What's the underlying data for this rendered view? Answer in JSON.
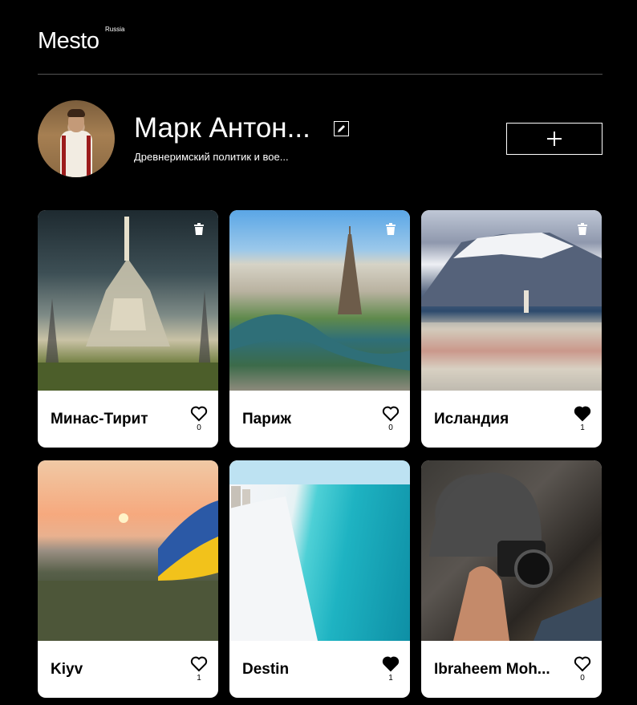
{
  "header": {
    "logo": "Mesto",
    "logo_sup": "Russia"
  },
  "profile": {
    "name": "Марк Антон...",
    "about": "Древнеримский политик и вое..."
  },
  "cards": [
    {
      "title": "Минас-Тирит",
      "likes": "0",
      "liked": false,
      "deletable": true,
      "image": "minas-tirith"
    },
    {
      "title": "Париж",
      "likes": "0",
      "liked": false,
      "deletable": true,
      "image": "paris"
    },
    {
      "title": "Исландия",
      "likes": "1",
      "liked": true,
      "deletable": true,
      "image": "iceland"
    },
    {
      "title": "Kiyv",
      "likes": "1",
      "liked": false,
      "deletable": false,
      "image": "kiyv"
    },
    {
      "title": "Destin",
      "likes": "1",
      "liked": true,
      "deletable": false,
      "image": "destin"
    },
    {
      "title": "Ibraheem Moh...",
      "likes": "0",
      "liked": false,
      "deletable": false,
      "image": "ibraheem"
    }
  ],
  "icons": {
    "edit": "pencil-icon",
    "add": "plus-icon",
    "like": "heart-icon",
    "delete": "trash-icon"
  },
  "colors": {
    "background": "#000000",
    "card": "#ffffff",
    "divider": "#545454",
    "text_dark": "#000000",
    "text_light": "#ffffff"
  }
}
